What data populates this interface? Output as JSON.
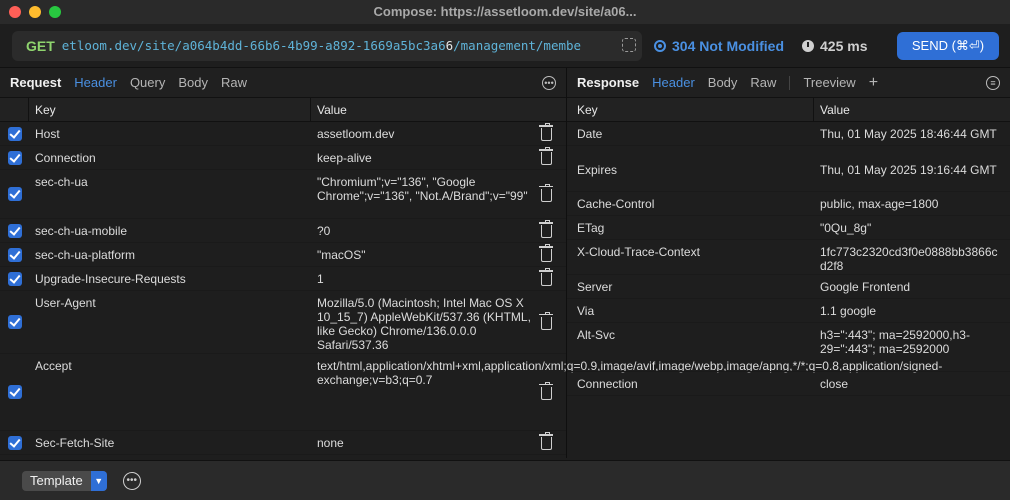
{
  "window": {
    "title": "Compose: https://assetloom.dev/site/a06..."
  },
  "urlbar": {
    "method": "GET",
    "url_start": "etloom.dev/site/a064b4dd-66b6-4b99-a892-1669a5bc3a6",
    "url_mid": "6",
    "url_end": "/management/membe",
    "status": "304 Not Modified",
    "time": "425 ms",
    "send_label": "SEND (⌘⏎)"
  },
  "request": {
    "heading": "Request",
    "tabs": [
      "Header",
      "Query",
      "Body",
      "Raw"
    ],
    "active_tab": "Header",
    "columns": {
      "key": "Key",
      "value": "Value"
    },
    "rows": [
      {
        "key": "Host",
        "value": "assetloom.dev"
      },
      {
        "key": "Connection",
        "value": "keep-alive"
      },
      {
        "key": "sec-ch-ua",
        "value": "\"Chromium\";v=\"136\", \"Google Chrome\";v=\"136\", \"Not.A/Brand\";v=\"99\""
      },
      {
        "key": "sec-ch-ua-mobile",
        "value": "?0"
      },
      {
        "key": "sec-ch-ua-platform",
        "value": "\"macOS\""
      },
      {
        "key": "Upgrade-Insecure-Requests",
        "value": "1"
      },
      {
        "key": "User-Agent",
        "value": "Mozilla/5.0 (Macintosh; Intel Mac OS X 10_15_7) AppleWebKit/537.36 (KHTML, like Gecko) Chrome/136.0.0.0 Safari/537.36"
      },
      {
        "key": "Accept",
        "value": "text/html,application/xhtml+xml,application/xml;q=0.9,image/avif,image/webp,image/apng,*/*;q=0.8,application/signed-exchange;v=b3;q=0.7"
      },
      {
        "key": "Sec-Fetch-Site",
        "value": "none"
      }
    ]
  },
  "response": {
    "heading": "Response",
    "tabs": [
      "Header",
      "Body",
      "Raw",
      "Treeview"
    ],
    "active_tab": "Header",
    "add_label": "+",
    "columns": {
      "key": "Key",
      "value": "Value"
    },
    "rows": [
      {
        "key": "Date",
        "value": "Thu, 01 May 2025 18:46:44 GMT"
      },
      {
        "key": "Expires",
        "value": "Thu, 01 May 2025 19:16:44 GMT"
      },
      {
        "key": "Cache-Control",
        "value": "public, max-age=1800"
      },
      {
        "key": "ETag",
        "value": "\"0Qu_8g\""
      },
      {
        "key": "X-Cloud-Trace-Context",
        "value": "1fc773c2320cd3f0e0888bb3866cd2f8"
      },
      {
        "key": "Server",
        "value": "Google Frontend"
      },
      {
        "key": "Via",
        "value": "1.1 google"
      },
      {
        "key": "Alt-Svc",
        "value": "h3=\":443\"; ma=2592000,h3-29=\":443\"; ma=2592000"
      },
      {
        "key": "Connection",
        "value": "close"
      }
    ]
  },
  "bottombar": {
    "template_label": "Template"
  }
}
